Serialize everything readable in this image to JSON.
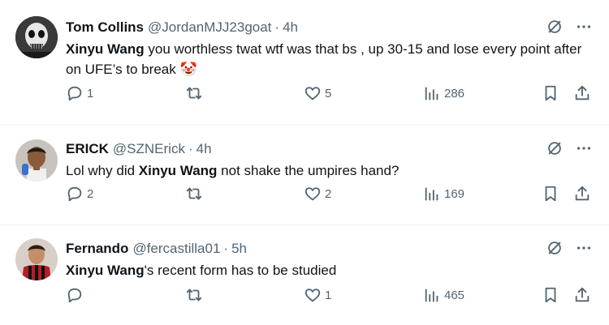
{
  "tweets": [
    {
      "name": "Tom Collins",
      "handle": "@JordanMJJ23goat",
      "separator": "·",
      "time": "4h",
      "mention": "Xinyu Wang",
      "text_after": " you worthless twat wtf was that bs , up 30-15 and lose every point after on UFE’s to break 🤡",
      "replies": "1",
      "reposts": "",
      "likes": "5",
      "views": "286"
    },
    {
      "name": "ERICK",
      "handle": "@SZNErick",
      "separator": "·",
      "time": "4h",
      "text_before": "Lol why did ",
      "mention": "Xinyu Wang",
      "text_after": " not shake the umpires hand?",
      "replies": "2",
      "reposts": "",
      "likes": "2",
      "views": "169"
    },
    {
      "name": "Fernando",
      "handle": "@fercastilla01",
      "separator": "·",
      "time": "5h",
      "mention": "Xinyu Wang",
      "text_after": "'s recent form has to be studied",
      "replies": "",
      "reposts": "",
      "likes": "1",
      "views": "465"
    }
  ],
  "icons": {
    "header": [
      "grok-slash-icon",
      "more-icon"
    ],
    "actions": [
      "reply-icon",
      "repost-icon",
      "like-icon",
      "views-icon",
      "bookmark-icon",
      "share-icon"
    ]
  },
  "colors": {
    "text": "#0f1419",
    "muted": "#536471",
    "divider": "#eff3f4"
  }
}
